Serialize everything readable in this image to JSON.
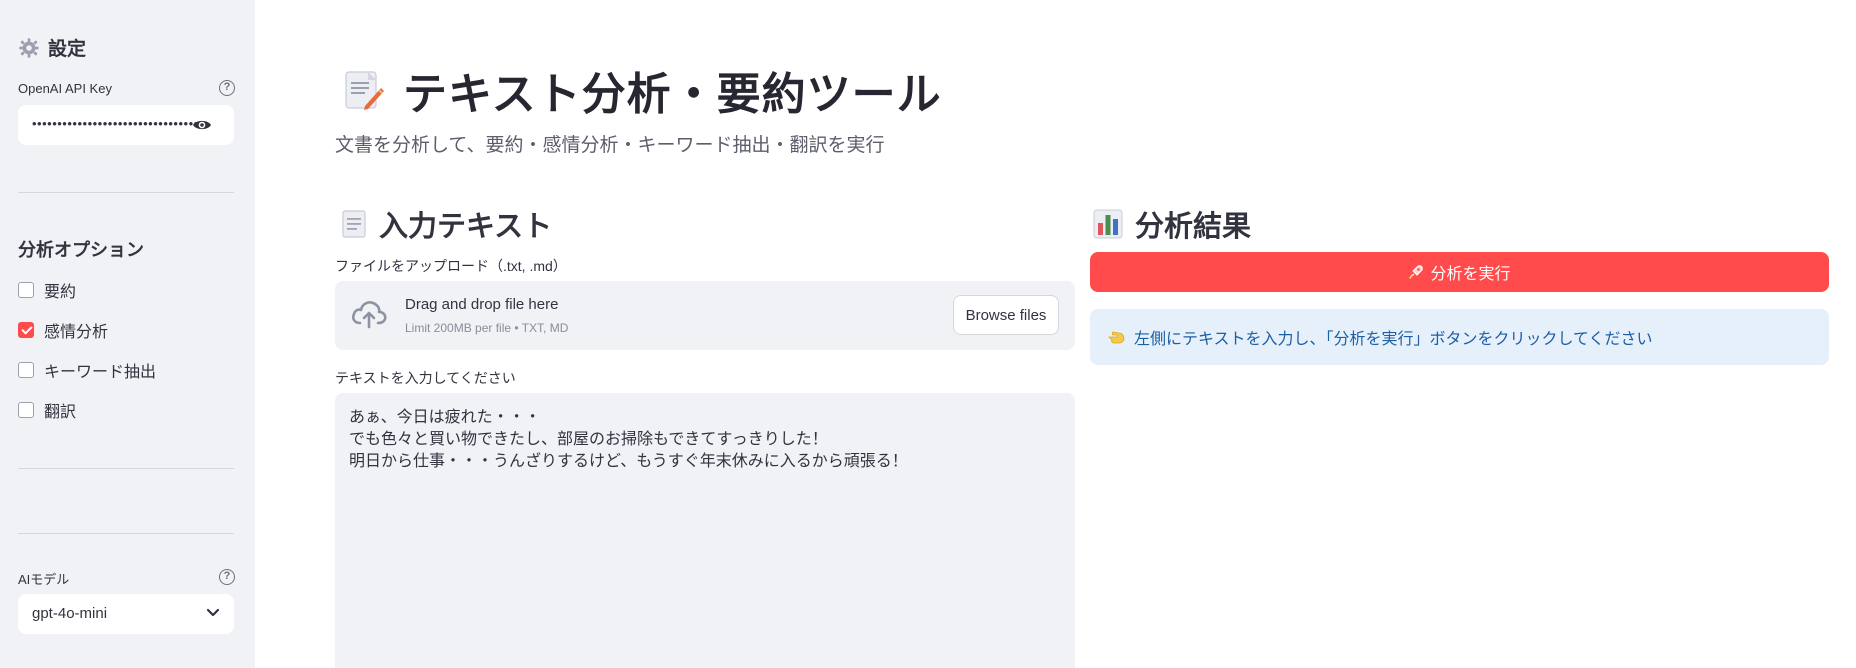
{
  "sidebar": {
    "title": "設定",
    "title_icon": "gear-icon",
    "api_key": {
      "label": "OpenAI API Key",
      "value": "•••••••••••••••••••••••••••••••••",
      "help": "?"
    },
    "options": {
      "heading": "分析オプション",
      "items": [
        {
          "label": "要約",
          "checked": false
        },
        {
          "label": "感情分析",
          "checked": true
        },
        {
          "label": "キーワード抽出",
          "checked": false
        },
        {
          "label": "翻訳",
          "checked": false
        }
      ]
    },
    "model": {
      "label": "AIモデル",
      "value": "gpt-4o-mini",
      "help": "?"
    }
  },
  "main": {
    "title": "テキスト分析・要約ツール",
    "subtitle": "文書を分析して、要約・感情分析・キーワード抽出・翻訳を実行",
    "input_section": {
      "heading": "入力テキスト",
      "upload_label": "ファイルをアップロード（.txt, .md）",
      "upload_main": "Drag and drop file here",
      "upload_sub": "Limit 200MB per file • TXT, MD",
      "browse_label": "Browse files",
      "text_label": "テキストを入力してください",
      "text_value": "あぁ、今日は疲れた・・・\nでも色々と買い物できたし、部屋のお掃除もできてすっきりした！\n明日から仕事・・・うんざりするけど、もうすぐ年末休みに入るから頑張る！"
    },
    "result_section": {
      "heading": "分析結果",
      "run_button": "分析を実行",
      "info_message": "左側にテキストを入力し、「分析を実行」ボタンをクリックしてください"
    }
  },
  "colors": {
    "accent": "#ff4b4b",
    "sidebar_bg": "#f0f2f6",
    "info_bg": "#e6f0fb",
    "info_text": "#1d5fa3"
  }
}
